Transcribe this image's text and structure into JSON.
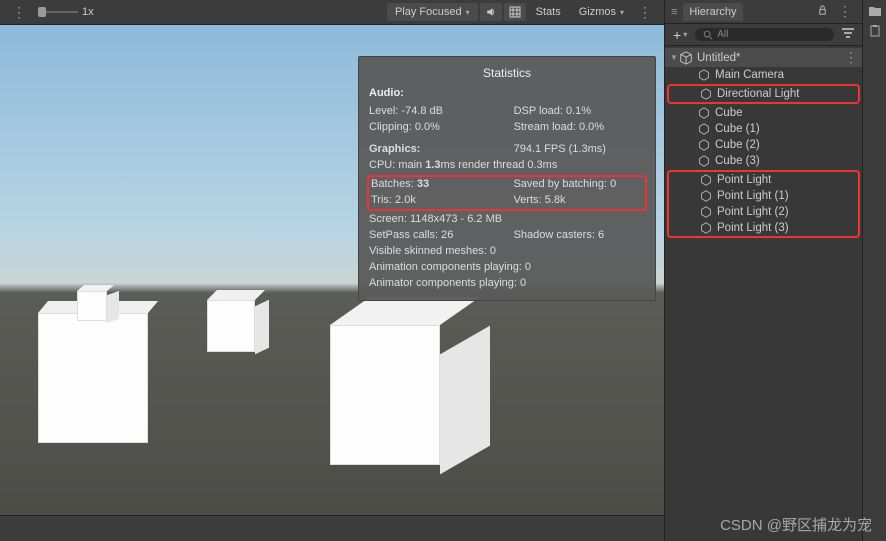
{
  "toolbar": {
    "scale_label": "1x",
    "display_mode": "Play Focused",
    "stats_label": "Stats",
    "gizmos_label": "Gizmos"
  },
  "stats": {
    "title": "Statistics",
    "audio_heading": "Audio:",
    "audio_level": "Level: -74.8 dB",
    "dsp_load": "DSP load: 0.1%",
    "clipping": "Clipping: 0.0%",
    "stream_load": "Stream load: 0.0%",
    "graphics_heading": "Graphics:",
    "fps": "794.1 FPS (1.3ms)",
    "cpu_pre": "CPU: main ",
    "cpu_bold": "1.3",
    "cpu_post": "ms  render thread 0.3ms",
    "batches_pre": "Batches: ",
    "batches_bold": "33",
    "saved_batching": "Saved by batching: 0",
    "tris": "Tris: 2.0k",
    "verts": "Verts: 5.8k",
    "screen": "Screen: 1148x473 - 6.2 MB",
    "setpass": "SetPass calls: 26",
    "shadow_casters": "Shadow casters: 6",
    "skinned_meshes": "Visible skinned meshes: 0",
    "anim_components": "Animation components playing: 0",
    "animator_components": "Animator components playing: 0"
  },
  "hierarchy": {
    "tab_label": "Hierarchy",
    "search_placeholder": "All",
    "scene": "Untitled*",
    "items": {
      "camera": "Main Camera",
      "dir_light": "Directional Light",
      "cube": "Cube",
      "cube1": "Cube (1)",
      "cube2": "Cube (2)",
      "cube3": "Cube (3)",
      "pl": "Point Light",
      "pl1": "Point Light (1)",
      "pl2": "Point Light (2)",
      "pl3": "Point Light (3)"
    }
  },
  "watermark": "CSDN @野区捕龙为宠"
}
